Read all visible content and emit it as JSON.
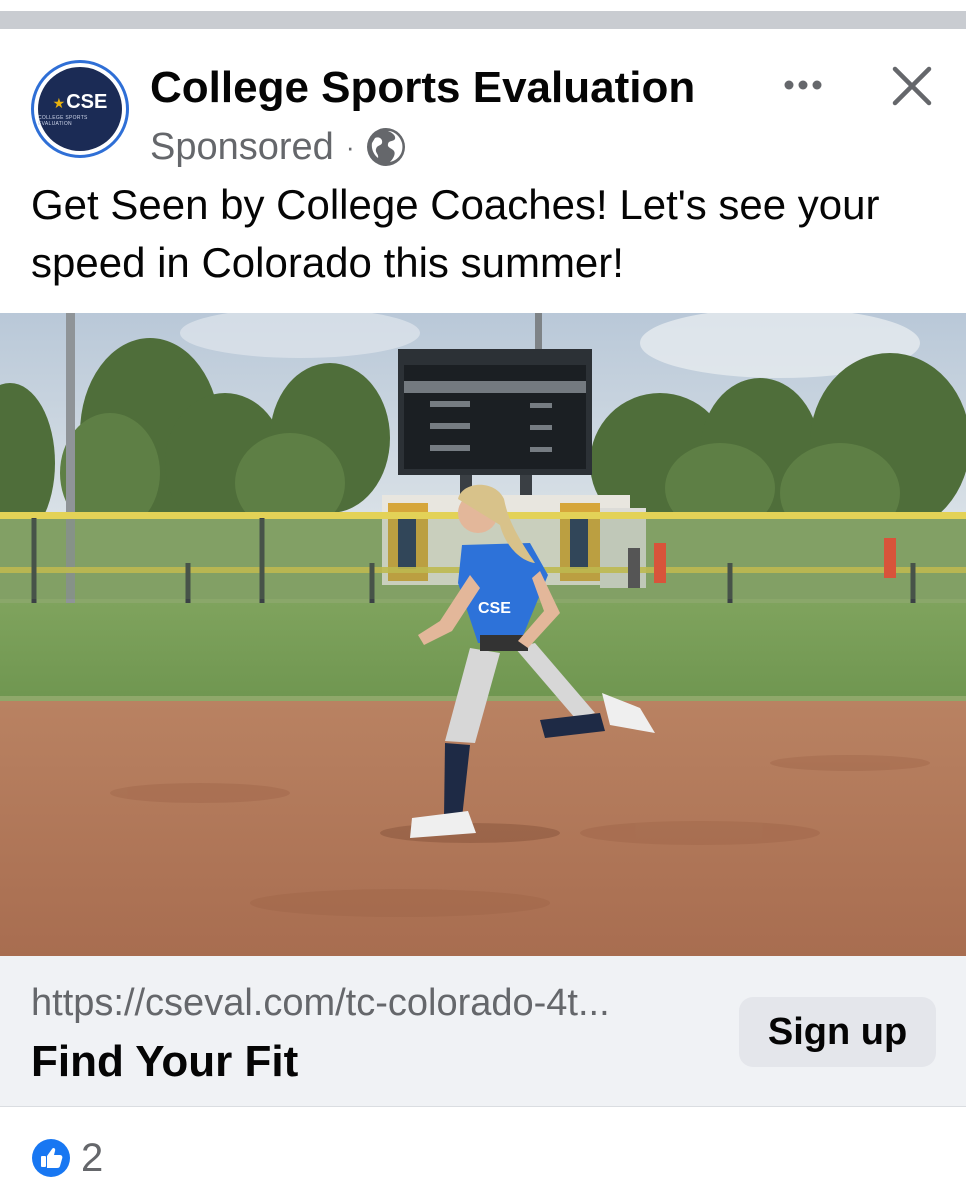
{
  "post": {
    "page_name": "College Sports Evaluation",
    "sponsored_label": "Sponsored",
    "separator": "·",
    "avatar_text": "CSE",
    "avatar_subtext": "COLLEGE SPORTS EVALUATION",
    "text": "Get Seen by College Coaches! Let's see your speed in Colorado this summer!"
  },
  "link": {
    "url": "https://cseval.com/tc-colorado-4t...",
    "title": "Find Your Fit",
    "cta_label": "Sign up"
  },
  "reactions": {
    "count": "2"
  },
  "icons": {
    "globe": "globe-icon",
    "more": "more-options-icon",
    "close": "close-icon",
    "like": "like-icon"
  },
  "colors": {
    "accent": "#1877f2",
    "avatar_ring": "#2f6fd6",
    "avatar_bg": "#1b2b55",
    "jersey": "#2d72d9",
    "cta_bg": "#e4e6eb",
    "link_bg": "#f0f2f5"
  }
}
